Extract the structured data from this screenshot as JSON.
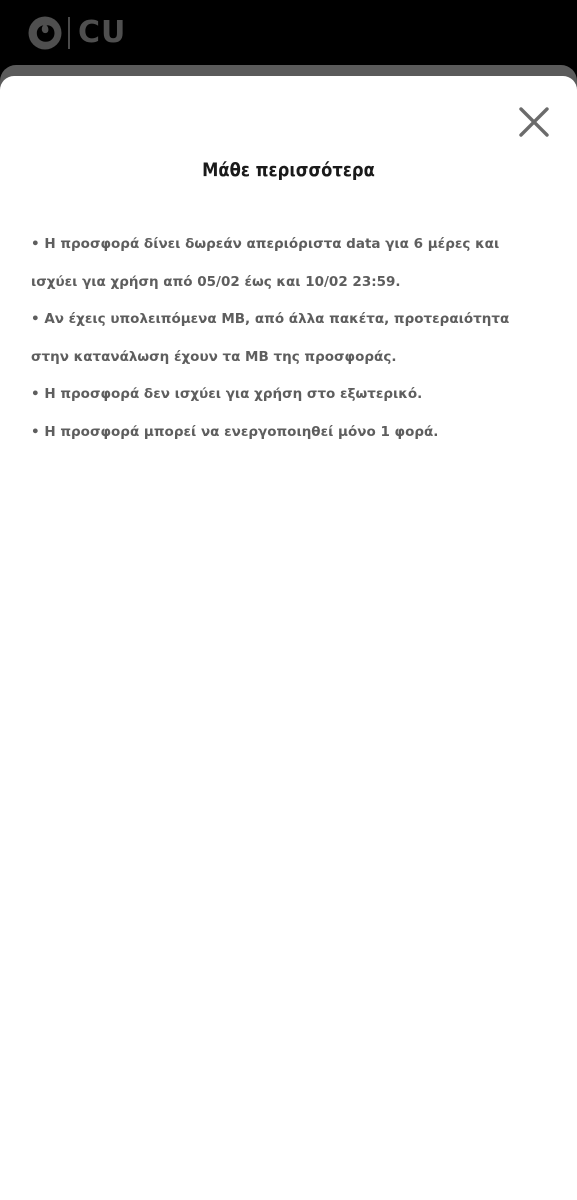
{
  "header": {
    "brand_text": "CU",
    "brand_icon": "vodafone-speechmark-logo"
  },
  "sheet": {
    "close_icon": "close-x-icon",
    "title": "Μάθε περισσότερα",
    "bullets": [
      "• Η προσφορά δίνει δωρεάν απεριόριστα data για 6 μέρες και ισχύει για χρήση από 05/02 έως και 10/02 23:59.",
      "• Αν έχεις υπολειπόμενα MB, από άλλα πακέτα, προτεραιότητα στην κατανάλωση έχουν τα MB της προσφοράς.",
      "• Η προσφορά δεν ισχύει για χρήση στο εξωτερικό.",
      "• Η προσφορά μπορεί να ενεργοποιηθεί μόνο 1 φορά."
    ]
  },
  "colors": {
    "header_bg": "#000000",
    "sheet_bg": "#ffffff",
    "title_color": "#1a1a1a",
    "body_text": "#5e5e5e",
    "close_icon": "#6b6b6b"
  }
}
